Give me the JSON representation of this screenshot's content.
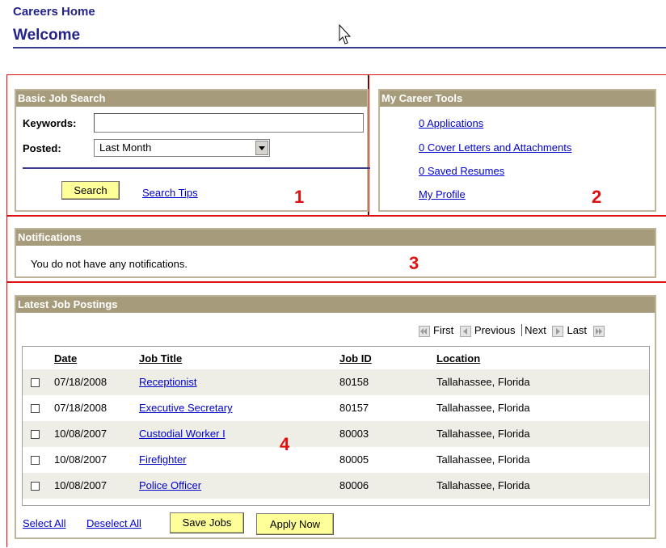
{
  "header": {
    "breadcrumb": "Careers Home",
    "title": "Welcome"
  },
  "basic_search": {
    "title": "Basic Job Search",
    "keywords_label": "Keywords:",
    "keywords_value": "",
    "posted_label": "Posted:",
    "posted_selected": "Last Month",
    "search_button": "Search",
    "search_tips_link": "Search Tips",
    "annotation": "1"
  },
  "career_tools": {
    "title": "My Career Tools",
    "links": [
      "0 Applications",
      "0 Cover Letters and Attachments",
      "0 Saved Resumes",
      "My Profile"
    ],
    "annotation": "2"
  },
  "notifications": {
    "title": "Notifications",
    "message": "You do not have any notifications.",
    "annotation": "3"
  },
  "postings": {
    "title": "Latest Job Postings",
    "nav": {
      "first": "First",
      "previous": "Previous",
      "next": "Next",
      "last": "Last"
    },
    "columns": {
      "date": "Date",
      "title": "Job Title",
      "id": "Job ID",
      "location": "Location"
    },
    "rows": [
      {
        "date": "07/18/2008",
        "title": "Receptionist",
        "id": "80158",
        "location": "Tallahassee, Florida"
      },
      {
        "date": "07/18/2008",
        "title": "Executive Secretary",
        "id": "80157",
        "location": "Tallahassee, Florida"
      },
      {
        "date": "10/08/2007",
        "title": "Custodial Worker I",
        "id": "80003",
        "location": "Tallahassee, Florida"
      },
      {
        "date": "10/08/2007",
        "title": "Firefighter",
        "id": "80005",
        "location": "Tallahassee, Florida"
      },
      {
        "date": "10/08/2007",
        "title": "Police Officer",
        "id": "80006",
        "location": "Tallahassee, Florida"
      }
    ],
    "select_all": "Select All",
    "deselect_all": "Deselect All",
    "save_jobs": "Save Jobs",
    "apply_now": "Apply Now",
    "annotation": "4"
  },
  "colors": {
    "header_bar": "#a69c7c",
    "title": "#23238a",
    "button": "#ffff99",
    "annotation_red": "#e01010"
  },
  "icons": [
    "mouse-pointer-icon",
    "dropdown-arrow-icon",
    "first-page-icon",
    "previous-page-icon",
    "next-page-icon",
    "last-page-icon"
  ]
}
